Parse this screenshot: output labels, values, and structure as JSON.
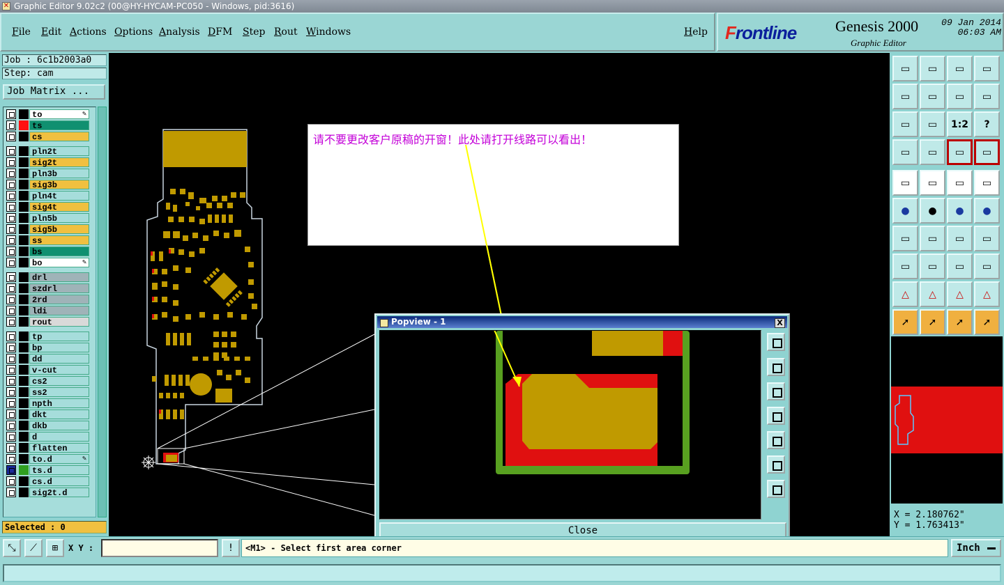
{
  "window": {
    "title": "Graphic Editor 9.02c2 (00@HY-HYCAM-PC050 - Windows, pid:3616)"
  },
  "menu": [
    "File",
    "Edit",
    "Actions",
    "Options",
    "Analysis",
    "DFM",
    "Step",
    "Rout",
    "Windows"
  ],
  "help": "Help",
  "brand": {
    "logo_prefix": "F",
    "logo": "rontline",
    "product": "Genesis 2000",
    "subtitle": "Graphic Editor",
    "date": "09 Jan 2014",
    "time": "06:03 AM"
  },
  "job": {
    "job": "Job : 6c1b2003a0",
    "step": "Step: cam",
    "matrix_button": "Job Matrix ..."
  },
  "layers": [
    {
      "name": "to",
      "color": "#ffffff",
      "swatch": "#000000",
      "edit": true
    },
    {
      "name": "ts",
      "color": "#109070",
      "swatch": "#ff1010",
      "edit": false
    },
    {
      "name": "cs",
      "color": "#f0c040",
      "swatch": "#000000",
      "edit": false
    },
    {
      "name": "pln2t",
      "color": "#a6dddb",
      "swatch": "#000000",
      "edit": false
    },
    {
      "name": "sig2t",
      "color": "#f0c040",
      "swatch": "#000000",
      "edit": false
    },
    {
      "name": "pln3b",
      "color": "#a6dddb",
      "swatch": "#000000",
      "edit": false
    },
    {
      "name": "sig3b",
      "color": "#f0c040",
      "swatch": "#000000",
      "edit": false
    },
    {
      "name": "pln4t",
      "color": "#a6dddb",
      "swatch": "#000000",
      "edit": false
    },
    {
      "name": "sig4t",
      "color": "#f0c040",
      "swatch": "#000000",
      "edit": false
    },
    {
      "name": "pln5b",
      "color": "#a6dddb",
      "swatch": "#000000",
      "edit": false
    },
    {
      "name": "sig5b",
      "color": "#f0c040",
      "swatch": "#000000",
      "edit": false
    },
    {
      "name": "ss",
      "color": "#f0c040",
      "swatch": "#000000",
      "edit": false
    },
    {
      "name": "bs",
      "color": "#109070",
      "swatch": "#000000",
      "edit": false
    },
    {
      "name": "bo",
      "color": "#ffffff",
      "swatch": "#000000",
      "edit": true
    },
    {
      "name": "drl",
      "color": "#9fb3b8",
      "swatch": "#000000",
      "edit": false
    },
    {
      "name": "szdrl",
      "color": "#9fb3b8",
      "swatch": "#000000",
      "edit": false
    },
    {
      "name": "2rd",
      "color": "#9fb3b8",
      "swatch": "#000000",
      "edit": false
    },
    {
      "name": "ldi",
      "color": "#9fb3b8",
      "swatch": "#000000",
      "edit": false
    },
    {
      "name": "rout",
      "color": "#d9d9d9",
      "swatch": "#000000",
      "edit": false
    },
    {
      "name": "tp",
      "color": "#a6dddb",
      "swatch": "#000000",
      "edit": false
    },
    {
      "name": "bp",
      "color": "#a6dddb",
      "swatch": "#000000",
      "edit": false
    },
    {
      "name": "dd",
      "color": "#a6dddb",
      "swatch": "#000000",
      "edit": false
    },
    {
      "name": "v-cut",
      "color": "#a6dddb",
      "swatch": "#000000",
      "edit": false
    },
    {
      "name": "cs2",
      "color": "#a6dddb",
      "swatch": "#000000",
      "edit": false
    },
    {
      "name": "ss2",
      "color": "#a6dddb",
      "swatch": "#000000",
      "edit": false
    },
    {
      "name": "npth",
      "color": "#a6dddb",
      "swatch": "#000000",
      "edit": false
    },
    {
      "name": "dkt",
      "color": "#a6dddb",
      "swatch": "#000000",
      "edit": false
    },
    {
      "name": "dkb",
      "color": "#a6dddb",
      "swatch": "#000000",
      "edit": false
    },
    {
      "name": "d",
      "color": "#a6dddb",
      "swatch": "#000000",
      "edit": false
    },
    {
      "name": "flatten",
      "color": "#a6dddb",
      "swatch": "#000000",
      "edit": false
    },
    {
      "name": "to.d",
      "color": "#a6dddb",
      "swatch": "#000000",
      "edit": true
    },
    {
      "name": "ts.d",
      "color": "#a6dddb",
      "swatch": "#30a020",
      "edit": false
    },
    {
      "name": "cs.d",
      "color": "#a6dddb",
      "swatch": "#000000",
      "edit": false
    },
    {
      "name": "sig2t.d",
      "color": "#a6dddb",
      "swatch": "#000000",
      "edit": false
    }
  ],
  "selected": "Selected : 0",
  "annotation": "请不要更改客户原稿的开窗！此处请打开线路可以看出！",
  "popview": {
    "title": "Popview - 1",
    "close_x": "X",
    "close": "Close"
  },
  "coords": {
    "x": "X = 2.180762\"",
    "y": "Y = 1.763413\""
  },
  "statusbar": {
    "xy_label": "X Y :",
    "xy_value": "",
    "message": "<M1> - Select first area corner",
    "units": "Inch"
  },
  "toolbar_labels": [
    "1:2",
    "?"
  ]
}
